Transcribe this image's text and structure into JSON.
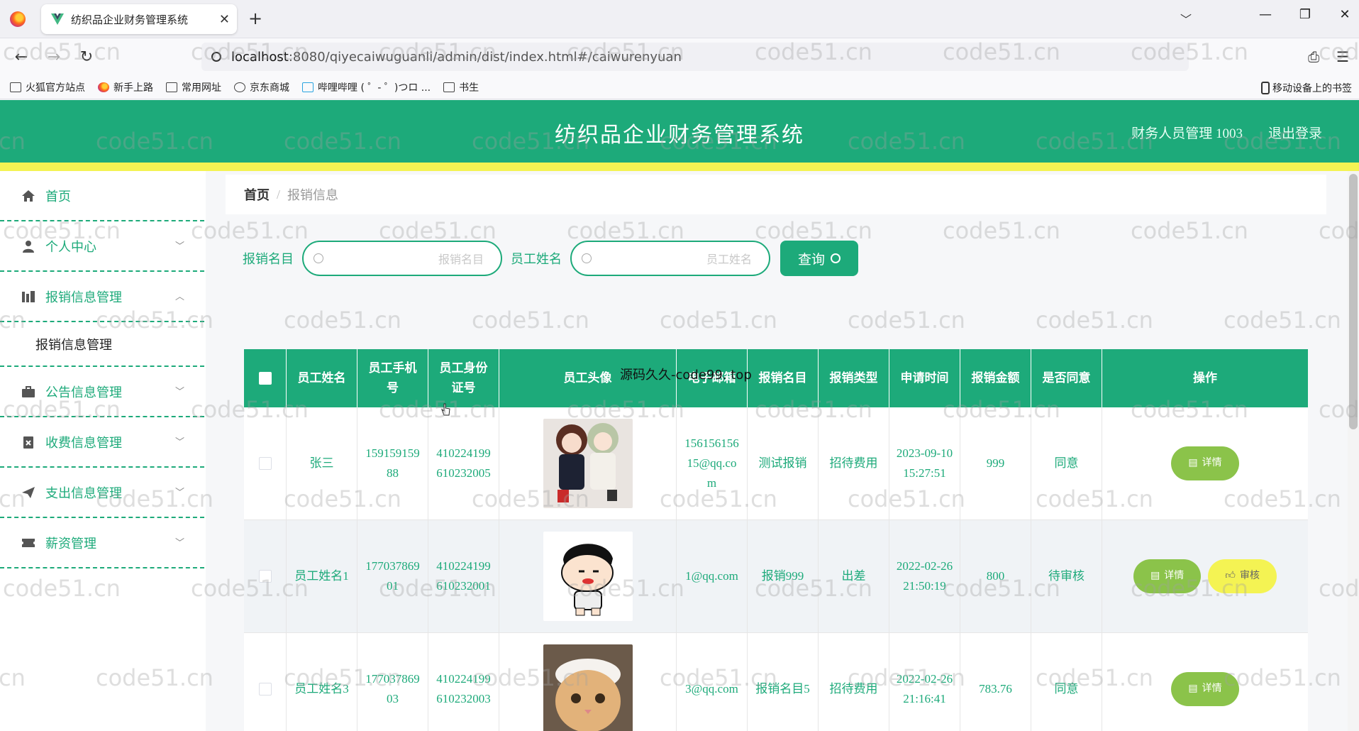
{
  "browser": {
    "tab_title": "纺织品企业财务管理系统",
    "url_host": "localhost",
    "url_rest": ":8080/qiyecaiwuguanli/admin/dist/index.html#/caiwurenyuan",
    "bookmarks": [
      "火狐官方站点",
      "新手上路",
      "常用网址",
      "京东商城",
      "哔哩哔哩 ( ゜- ゜)つロ ...",
      "书生"
    ],
    "mobile_bookmarks": "移动设备上的书签"
  },
  "header": {
    "title": "纺织品企业财务管理系统",
    "user": "财务人员管理 1003",
    "logout": "退出登录"
  },
  "sidebar": {
    "items": [
      {
        "label": "首页",
        "icon": "home-icon"
      },
      {
        "label": "个人中心",
        "icon": "user-icon"
      },
      {
        "label": "报销信息管理",
        "icon": "chart-icon"
      },
      {
        "label": "公告信息管理",
        "icon": "briefcase-icon"
      },
      {
        "label": "收费信息管理",
        "icon": "clipboard-icon"
      },
      {
        "label": "支出信息管理",
        "icon": "send-icon"
      },
      {
        "label": "薪资管理",
        "icon": "ticket-icon"
      }
    ],
    "submenu_label": "报销信息管理"
  },
  "breadcrumb": {
    "home": "首页",
    "separator": "/",
    "current": "报销信息"
  },
  "search": {
    "label1": "报销名目",
    "placeholder1": "报销名目",
    "label2": "员工姓名",
    "placeholder2": "员工姓名",
    "button": "查询"
  },
  "table": {
    "headers": [
      "员工姓名",
      "员工手机号",
      "员工身份证号",
      "员工头像",
      "电子邮箱",
      "报销名目",
      "报销类型",
      "申请时间",
      "报销金额",
      "是否同意",
      "操作"
    ],
    "rows": [
      {
        "name": "张三",
        "phone": "15915915988",
        "id": "410224199610232005",
        "email": "15615615615@qq.com",
        "item": "测试报销",
        "type": "招待费用",
        "time": "2023-09-10 15:27:51",
        "amount": "999",
        "agree": "同意"
      },
      {
        "name": "员工姓名1",
        "phone": "17703786901",
        "id": "410224199610232001",
        "email": "1@qq.com",
        "item": "报销999",
        "type": "出差",
        "time": "2022-02-26 21:50:19",
        "amount": "800",
        "agree": "待审核"
      },
      {
        "name": "员工姓名3",
        "phone": "17703786903",
        "id": "410224199610232003",
        "email": "3@qq.com",
        "item": "报销名目5",
        "type": "招待费用",
        "time": "2022-02-26 21:16:41",
        "amount": "783.76",
        "agree": "同意"
      }
    ],
    "detail_label": "详情",
    "audit_label": "审核"
  },
  "overlay": "源码久久-code99. top",
  "watermark": "code51.cn",
  "colors": {
    "primary": "#1daa7a",
    "accent": "#f4f353",
    "detail": "#8bc34a"
  }
}
